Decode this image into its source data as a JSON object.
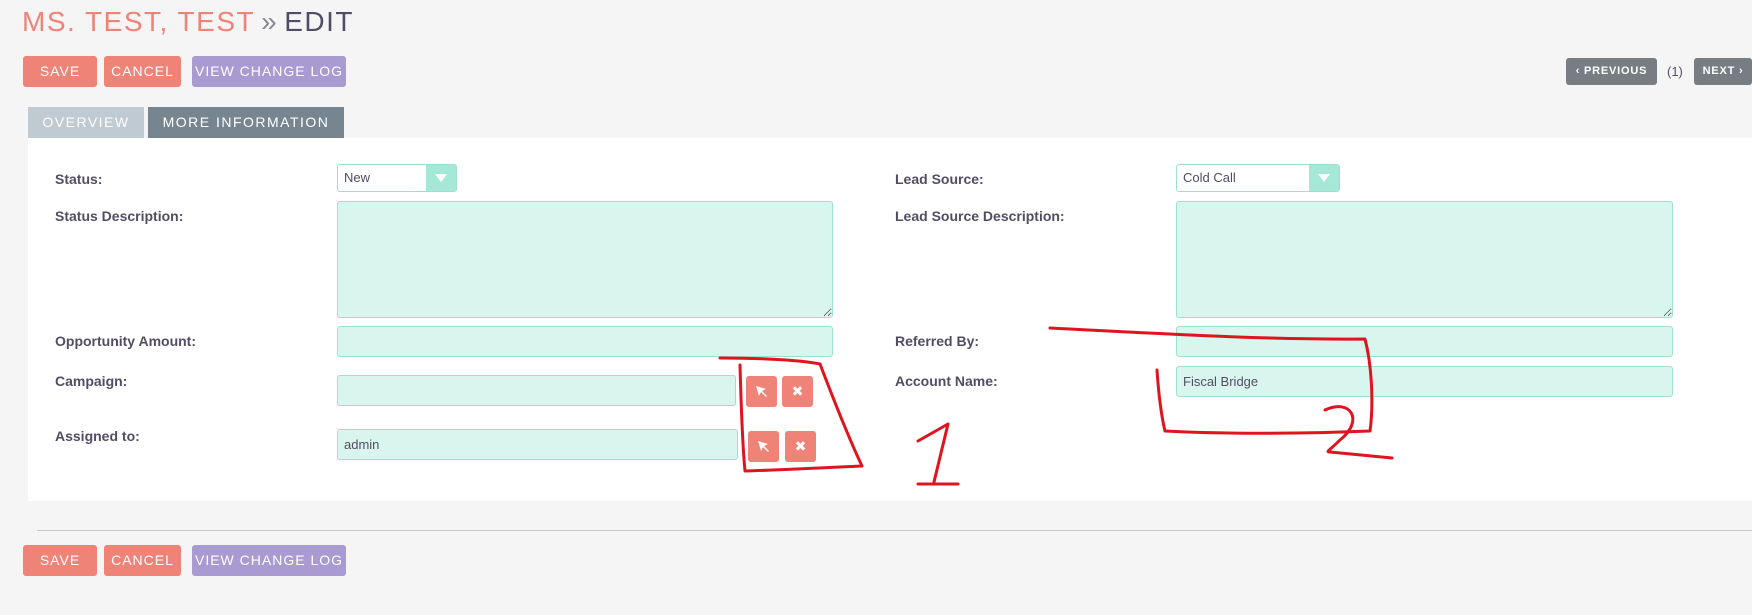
{
  "header": {
    "record_name": "MS. TEST, TEST",
    "separator": "»",
    "mode": "EDIT"
  },
  "toolbar": {
    "save_label": "SAVE",
    "cancel_label": "CANCEL",
    "changelog_label": "VIEW CHANGE LOG"
  },
  "pagination": {
    "previous_label": "PREVIOUS",
    "count": "(1)",
    "next_label": "NEXT"
  },
  "tabs": [
    {
      "label": "OVERVIEW",
      "active": false
    },
    {
      "label": "MORE INFORMATION",
      "active": true
    }
  ],
  "form": {
    "status": {
      "label": "Status:",
      "value": "New"
    },
    "status_description": {
      "label": "Status Description:",
      "value": ""
    },
    "opportunity_amount": {
      "label": "Opportunity Amount:",
      "value": ""
    },
    "campaign": {
      "label": "Campaign:",
      "value": ""
    },
    "assigned_to": {
      "label": "Assigned to:",
      "value": "admin"
    },
    "lead_source": {
      "label": "Lead Source:",
      "value": "Cold Call"
    },
    "lead_source_description": {
      "label": "Lead Source Description:",
      "value": ""
    },
    "referred_by": {
      "label": "Referred By:",
      "value": ""
    },
    "account_name": {
      "label": "Account Name:",
      "value": "Fiscal Bridge"
    }
  },
  "icons": {
    "select_icon": "arrow-pointer-icon",
    "clear_icon": "close-icon"
  },
  "colors": {
    "primary": "#f08377",
    "secondary": "#a99ad1",
    "field_bg": "#d8f5ee",
    "annotation": "#e0141e"
  }
}
